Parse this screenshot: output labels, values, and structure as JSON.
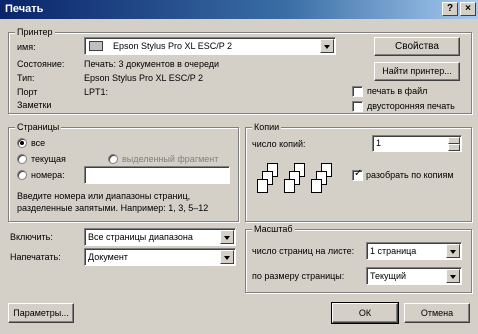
{
  "window": {
    "title": "Печать",
    "help_btn": "?",
    "close_btn": "×"
  },
  "printer": {
    "group_title": "Принтер",
    "name_label": "имя:",
    "name_value": "Epson Stylus Pro XL ESC/P 2",
    "status_label": "Состояние:",
    "status_value": "Печать: 3 документов в очереди",
    "type_label": "Тип:",
    "type_value": "Epson Stylus Pro XL ESC/P 2",
    "port_label": "Порт",
    "port_value": "LPT1:",
    "notes_label": "Заметки",
    "properties_btn": "Свойства",
    "find_printer_btn": "Найти принтер...",
    "print_to_file": "печать в файл",
    "duplex": "двусторонняя печать"
  },
  "pages": {
    "group_title": "Страницы",
    "all": "все",
    "current": "текущая",
    "selection": "выделенный фрагмент",
    "numbers": "номера:",
    "hint": "Введите номера или диапазоны страниц, разделенные запятыми. Например: 1, 3, 5–12",
    "hint_line1": "Введите номера или диапазоны страниц,",
    "hint_line2": "разделенные запятыми. Например: 1, 3, 5–12"
  },
  "copies": {
    "group_title": "Копии",
    "count_label": "число копий:",
    "count_value": "1",
    "collate_label": "разобрать по копиям"
  },
  "include": {
    "label": "Включить:",
    "value": "Все страницы диапазона"
  },
  "print_what": {
    "label": "Напечатать:",
    "value": "Документ"
  },
  "scale": {
    "group_title": "Масштаб",
    "per_sheet_label": "число страниц на листе:",
    "per_sheet_value": "1 страница",
    "fit_label": "по размеру страницы:",
    "fit_value": "Текущий"
  },
  "buttons": {
    "options": "Параметры...",
    "ok": "ОК",
    "cancel": "Отмена"
  }
}
